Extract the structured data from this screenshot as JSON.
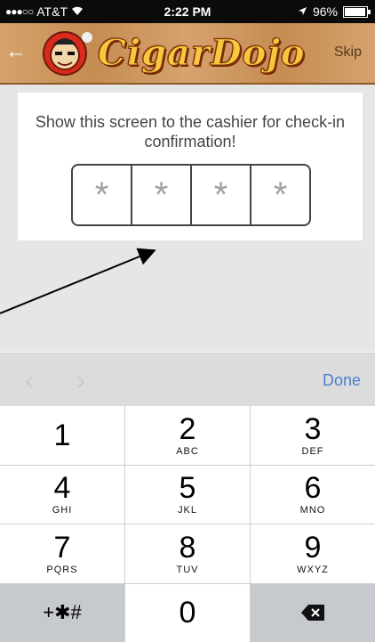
{
  "status_bar": {
    "signal": "●●●○○",
    "carrier": "AT&T",
    "time": "2:22 PM",
    "battery": "96%"
  },
  "header": {
    "logo_text": "CigarDojo",
    "skip_label": "Skip"
  },
  "checkin": {
    "message": "Show this screen to the cashier for check-in confirmation!",
    "code_cells": [
      "*",
      "*",
      "*",
      "*"
    ]
  },
  "accessory": {
    "done_label": "Done"
  },
  "keypad": {
    "keys": [
      {
        "digit": "1",
        "letters": ""
      },
      {
        "digit": "2",
        "letters": "ABC"
      },
      {
        "digit": "3",
        "letters": "DEF"
      },
      {
        "digit": "4",
        "letters": "GHI"
      },
      {
        "digit": "5",
        "letters": "JKL"
      },
      {
        "digit": "6",
        "letters": "MNO"
      },
      {
        "digit": "7",
        "letters": "PQRS"
      },
      {
        "digit": "8",
        "letters": "TUV"
      },
      {
        "digit": "9",
        "letters": "WXYZ"
      }
    ],
    "symbols_label": "+✱#",
    "zero": "0"
  }
}
